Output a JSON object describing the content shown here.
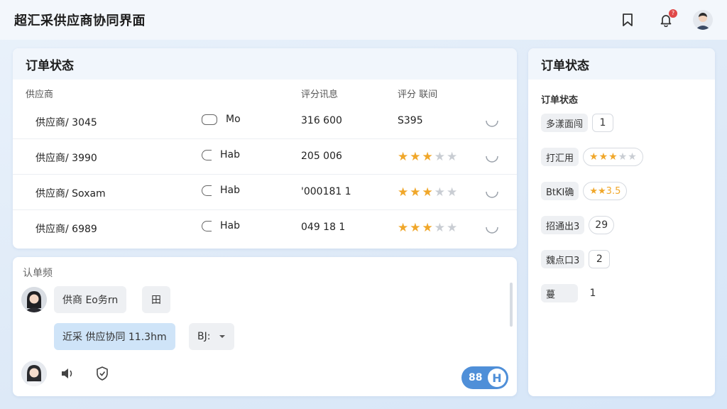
{
  "app": {
    "title": "超汇采供应商协同界面",
    "notification_count": "?"
  },
  "orders": {
    "title": "订单状态",
    "columns": [
      "供应商",
      "评分讯息",
      "评分 联间"
    ],
    "rows": [
      {
        "supplier": "供应商/ 3045",
        "tag": "Mo",
        "score": "316 600",
        "time_text": "S395",
        "rating": null
      },
      {
        "supplier": "供应商/ 3990",
        "tag": "Hab",
        "score": "205 006",
        "time_text": "",
        "rating": 3
      },
      {
        "supplier": "供应商/ Soxam",
        "tag": "Hab",
        "score": "'000181 1",
        "time_text": "",
        "rating": 3
      },
      {
        "supplier": "供应商/ 6989",
        "tag": "Hab",
        "score": "049 18 1",
        "time_text": "",
        "rating": 3
      }
    ]
  },
  "chat": {
    "label": "认单频",
    "message_1": "供商 Eo务rn",
    "message_1_action": "田",
    "message_2": "近采 供应协同 11.3hm",
    "select_value": "BJ:",
    "toggle_label": "88",
    "toggle_knob": "H"
  },
  "side": {
    "title": "订单状态",
    "subtitle": "订单状态",
    "items": [
      {
        "label": "多漾面闯",
        "value": "1"
      },
      {
        "label": "打汇用",
        "value": "",
        "rating": 3
      },
      {
        "label": "BtKI确",
        "value": "★★3.5"
      },
      {
        "label": "招通出3",
        "value": "29"
      },
      {
        "label": "魏点口3",
        "value": "2"
      },
      {
        "label": "蔓",
        "value": "1"
      }
    ]
  },
  "colors": {
    "accent": "#4f8fd8",
    "star": "#f0a72a",
    "highlight": "#cfe4f8"
  }
}
